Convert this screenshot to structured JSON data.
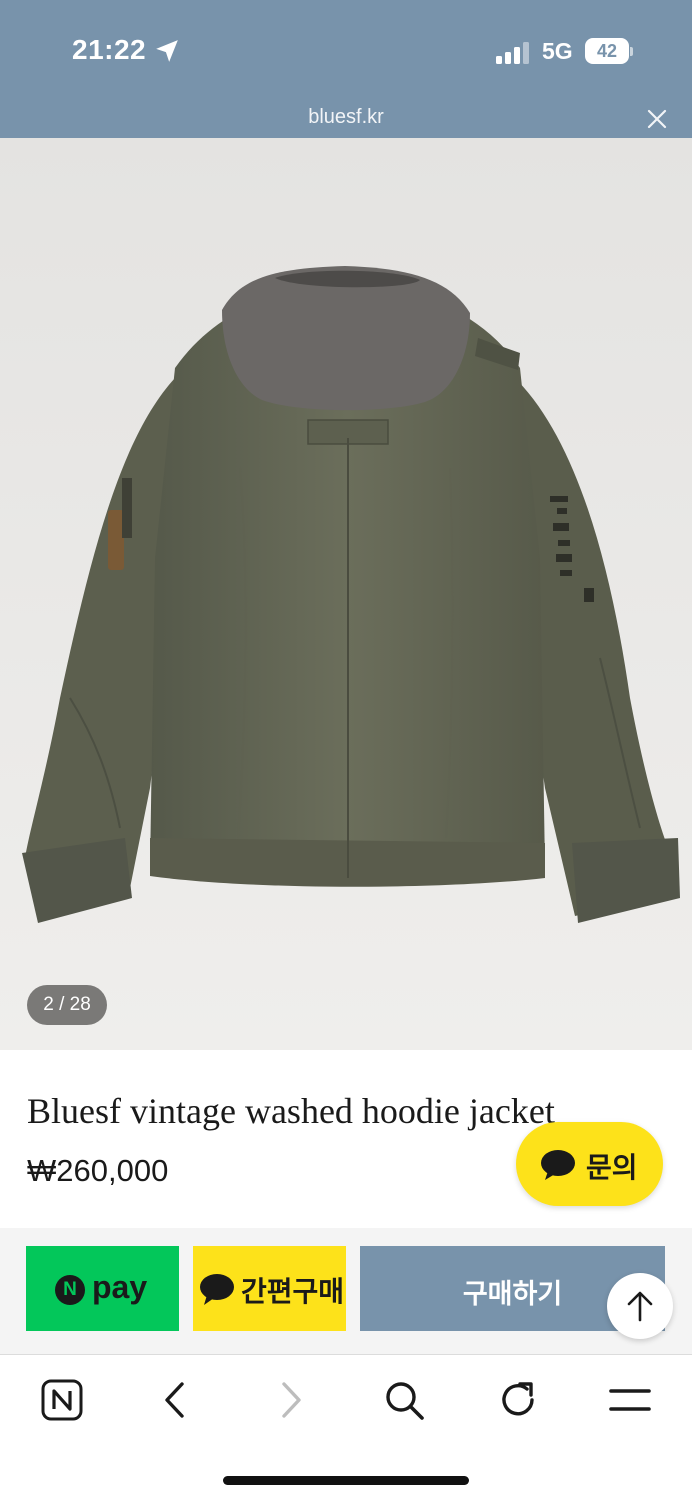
{
  "status_bar": {
    "time": "21:22",
    "network": "5G",
    "battery": "42"
  },
  "browser": {
    "url": "bluesf.kr"
  },
  "product": {
    "image_counter": "2 / 28",
    "title": "Bluesf vintage washed hoodie jacket",
    "price": "₩260,000"
  },
  "buttons": {
    "inquiry": "문의",
    "npay_badge": "N",
    "npay": "pay",
    "kakao_quick_buy": "간편구매",
    "purchase": "구매하기"
  },
  "colors": {
    "header_blue": "#7893ab",
    "kakao_yellow": "#fde21a",
    "npay_green": "#03c75a"
  },
  "icons": {
    "toolbar": [
      "naver-home-icon",
      "back-icon",
      "forward-icon",
      "search-icon",
      "reload-icon",
      "menu-icon"
    ]
  }
}
